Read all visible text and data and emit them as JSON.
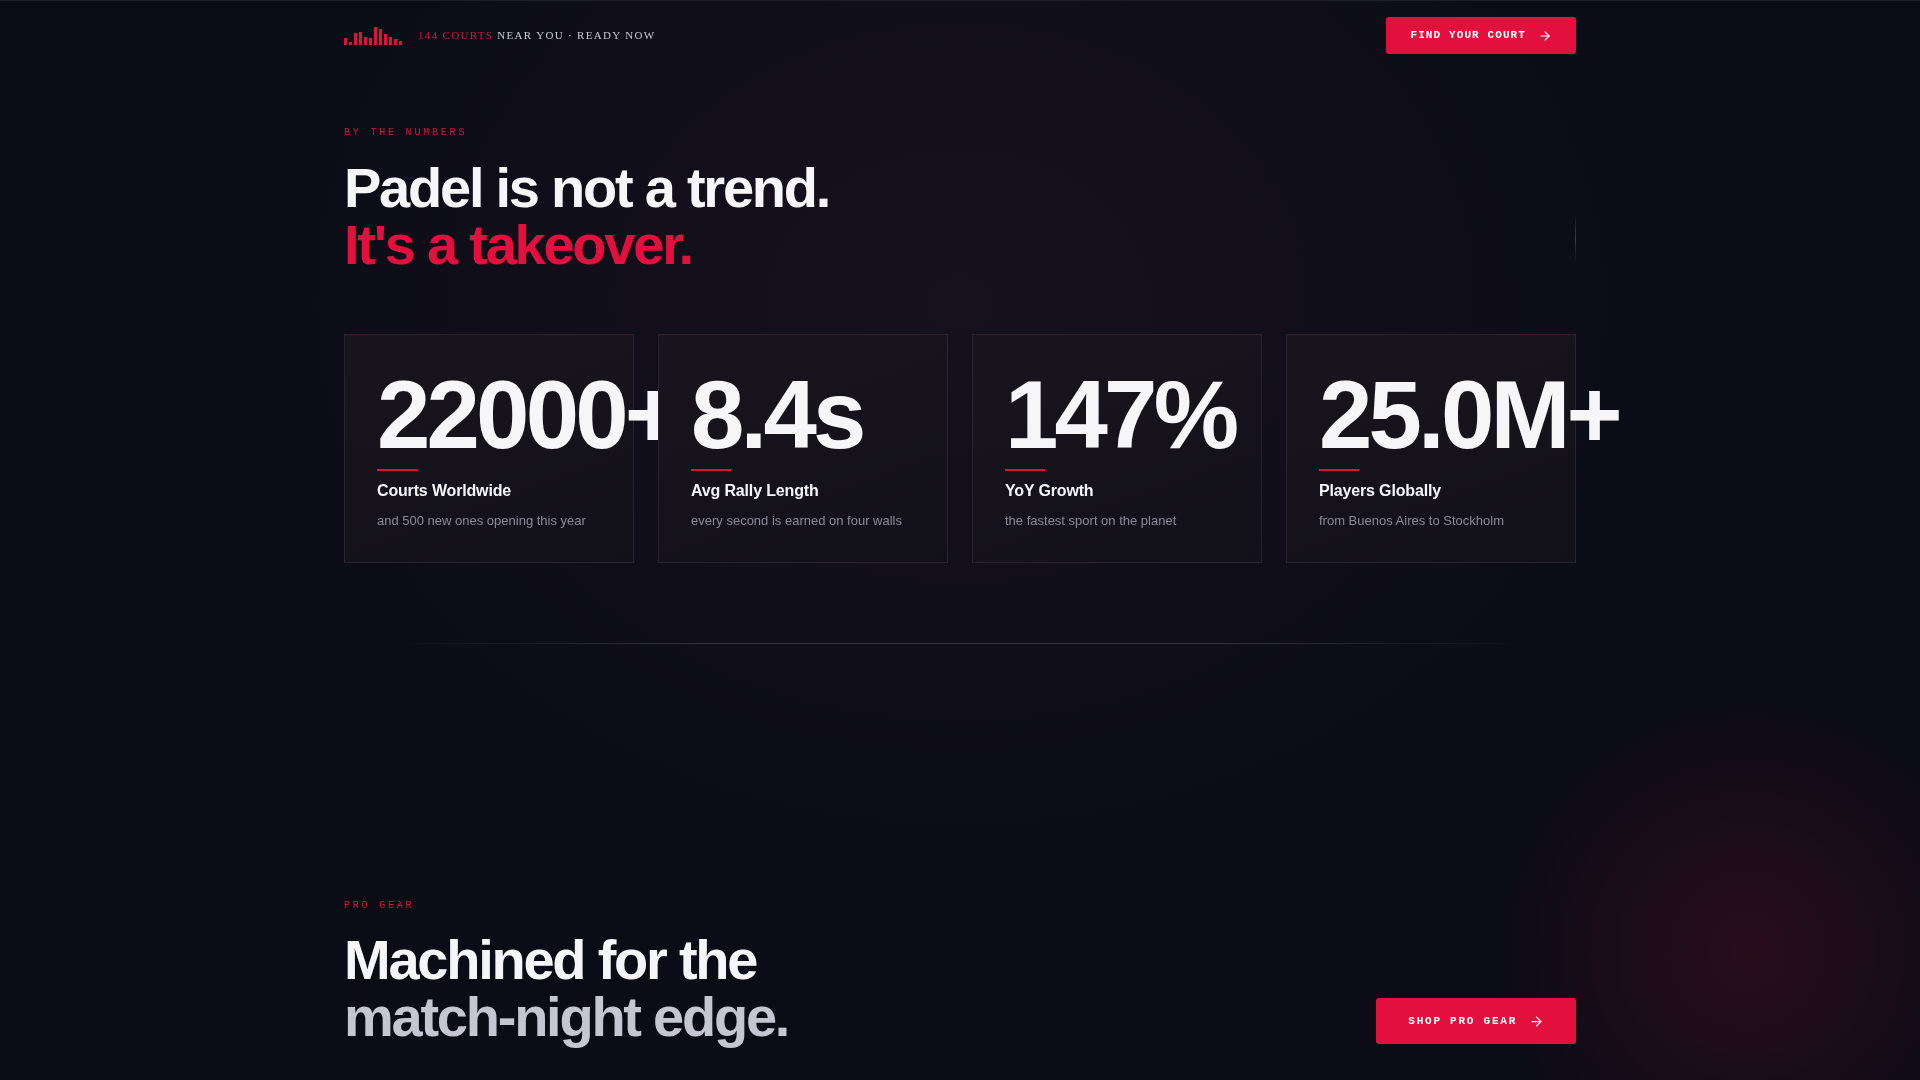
{
  "header": {
    "tagline": {
      "highlight": "144 COURTS",
      "text": "NEAR YOU · READY NOW"
    },
    "cta": {
      "label": "FIND YOUR COURT"
    }
  },
  "stats_section": {
    "eyebrow": "BY THE NUMBERS",
    "headline": "Padel is not a trend.",
    "headline_accent": "It's a takeover.",
    "stats": [
      {
        "value": "22000+",
        "label": "Courts Worldwide",
        "description": "and 500 new ones opening this year"
      },
      {
        "value": "8.4s",
        "label": "Avg Rally Length",
        "description": "every second is earned on four walls"
      },
      {
        "value": "147%",
        "label": "YoY Growth",
        "description": "the fastest sport on the planet"
      },
      {
        "value": "25.0M+",
        "label": "Players Globally",
        "description": "from Buenos Aires to Stockholm"
      }
    ]
  },
  "gear_section": {
    "eyebrow": "PRO GEAR",
    "headline": "Machined for the",
    "headline_muted": "match-night edge.",
    "cta": {
      "label": "SHOP PRO GEAR"
    }
  }
}
